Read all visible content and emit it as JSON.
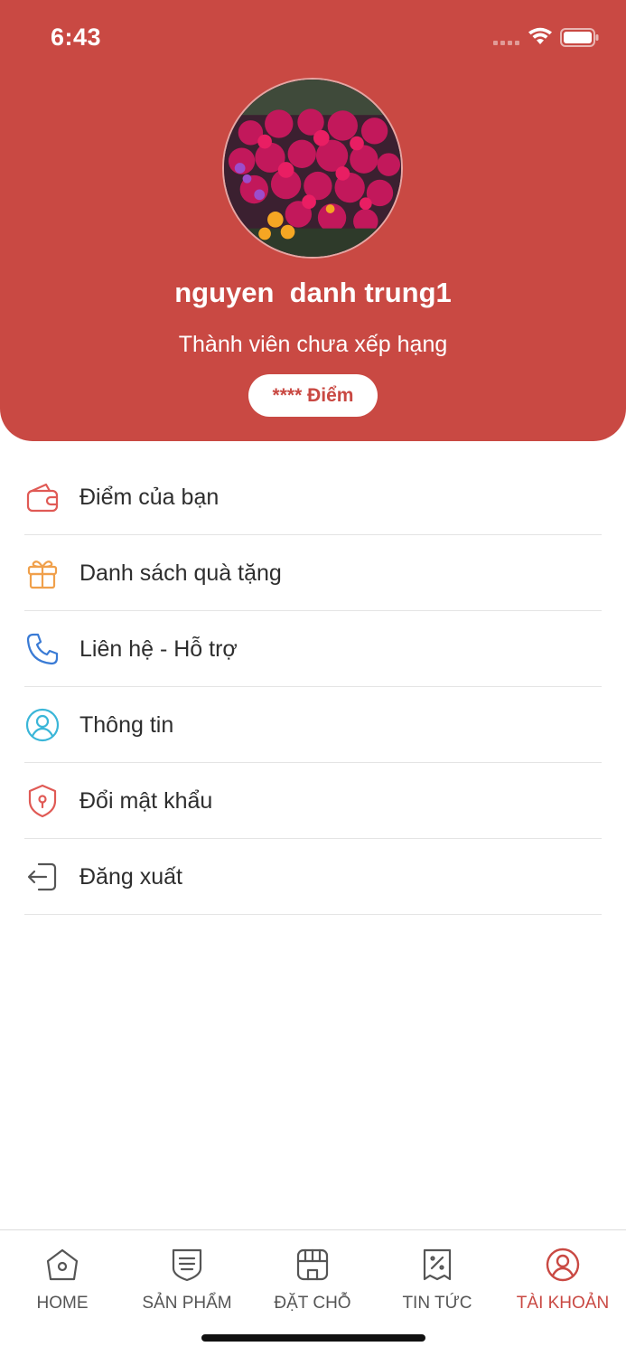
{
  "status_bar": {
    "time": "6:43"
  },
  "profile": {
    "name": "nguyen  danh trung1",
    "rank": "Thành viên chưa xếp hạng",
    "points_label": "**** Điểm"
  },
  "menu": [
    {
      "label": "Điểm của bạn",
      "icon": "wallet-icon",
      "color": "#e05a55"
    },
    {
      "label": "Danh sách quà tặng",
      "icon": "gift-icon",
      "color": "#f0a04b"
    },
    {
      "label": "Liên hệ - Hỗ trợ",
      "icon": "phone-icon",
      "color": "#3a7bd5"
    },
    {
      "label": "Thông tin",
      "icon": "user-circle-icon",
      "color": "#3ab6d8"
    },
    {
      "label": "Đổi mật khẩu",
      "icon": "shield-icon",
      "color": "#e05a55"
    },
    {
      "label": "Đăng xuất",
      "icon": "logout-icon",
      "color": "#555555"
    }
  ],
  "tabs": [
    {
      "label": "HOME",
      "icon": "home-icon",
      "active": false
    },
    {
      "label": "SẢN PHẨM",
      "icon": "product-icon",
      "active": false
    },
    {
      "label": "ĐẶT CHỖ",
      "icon": "store-icon",
      "active": false
    },
    {
      "label": "TIN TỨC",
      "icon": "news-icon",
      "active": false
    },
    {
      "label": "TÀI KHOẢN",
      "icon": "account-icon",
      "active": true
    }
  ],
  "colors": {
    "brand": "#c94943",
    "tab_inactive": "#555555"
  }
}
